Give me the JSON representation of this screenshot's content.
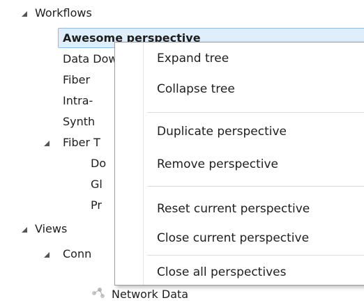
{
  "tree": {
    "workflows_label": "Workflows",
    "workflows_children": [
      "Awesome perspective",
      "Data Download",
      "Fiber",
      "Intra-",
      "Synth",
      "Fiber T"
    ],
    "fiber_children": [
      "Do",
      "Gl",
      "Pr"
    ],
    "views_label": "Views",
    "connectomes_label": "Conn",
    "network_data_label": "Network Data"
  },
  "context_menu": {
    "expand_tree": "Expand tree",
    "collapse_tree": "Collapse tree",
    "duplicate_perspective": "Duplicate perspective",
    "remove_perspective": "Remove perspective",
    "reset_current_perspective": "Reset current perspective",
    "close_current_perspective": "Close current perspective",
    "close_all_perspectives": "Close all perspectives"
  },
  "colors": {
    "selection_fill": "#dfeefb",
    "selection_border": "#8fb9e6",
    "text": "#1e1e1e",
    "toggle_arrow": "#555555"
  }
}
